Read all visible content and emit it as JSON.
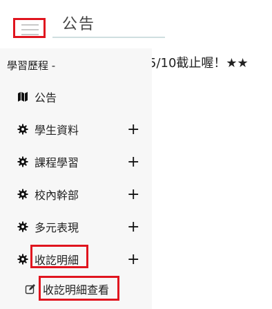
{
  "header": {
    "title": "公告"
  },
  "notice_text": "5/10截止喔！★★",
  "sidebar": {
    "header": "學習歷程 -",
    "items": [
      {
        "label": "公告",
        "icon": "map-icon",
        "expandable": false
      },
      {
        "label": "學生資料",
        "icon": "gear-icon",
        "expandable": true
      },
      {
        "label": "課程學習",
        "icon": "gear-icon",
        "expandable": true
      },
      {
        "label": "校內幹部",
        "icon": "gear-icon",
        "expandable": true
      },
      {
        "label": "多元表現",
        "icon": "gear-icon",
        "expandable": true
      },
      {
        "label": "收訖明細",
        "icon": "gear-icon",
        "expandable": true
      }
    ],
    "expand_symbol": "+",
    "sub_items": [
      {
        "label": "收訖明細查看",
        "icon": "edit-icon"
      }
    ]
  },
  "colors": {
    "highlight": "#e0141e",
    "sidebar_bg": "#f7f7f7",
    "underline": "#cfdfe0"
  }
}
